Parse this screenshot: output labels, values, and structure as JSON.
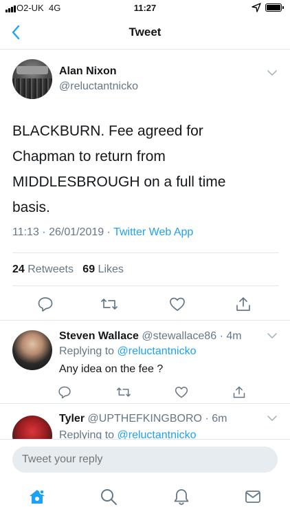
{
  "status_bar": {
    "carrier": "O2-UK",
    "network": "4G",
    "time": "11:27"
  },
  "nav": {
    "title": "Tweet",
    "back_icon": "chevron-left-icon"
  },
  "tweet": {
    "author_name": "Alan Nixon",
    "author_handle": "@reluctantnicko",
    "text": "BLACKBURN. Fee agreed for\nChapman to return from\nMIDDLESBROUGH on a full time\nbasis.",
    "timestamp": "11:13 · 26/01/2019 · ",
    "source": "Twitter Web App",
    "retweets_count": "24",
    "retweets_label": "Retweets",
    "likes_count": "69",
    "likes_label": "Likes"
  },
  "replies": [
    {
      "name": "Steven Wallace",
      "handle": "@stewallace86",
      "time": "· 4m",
      "replying_prefix": "Replying to ",
      "replying_to": "@reluctantnicko",
      "text": "Any idea on the fee ?"
    },
    {
      "name": "Tyler",
      "handle": "@UPTHEFKINGBORO",
      "time": "· 6m",
      "replying_prefix": "Replying to ",
      "replying_to": "@reluctantnicko"
    }
  ],
  "compose": {
    "placeholder": "Tweet your reply"
  },
  "tab_bar": {
    "items": [
      "home-icon",
      "search-icon",
      "notifications-icon",
      "messages-icon"
    ]
  },
  "colors": {
    "accent": "#1da1f2",
    "secondary_text": "#657786",
    "primary_text": "#14171a",
    "divider": "#e1e8ed"
  }
}
